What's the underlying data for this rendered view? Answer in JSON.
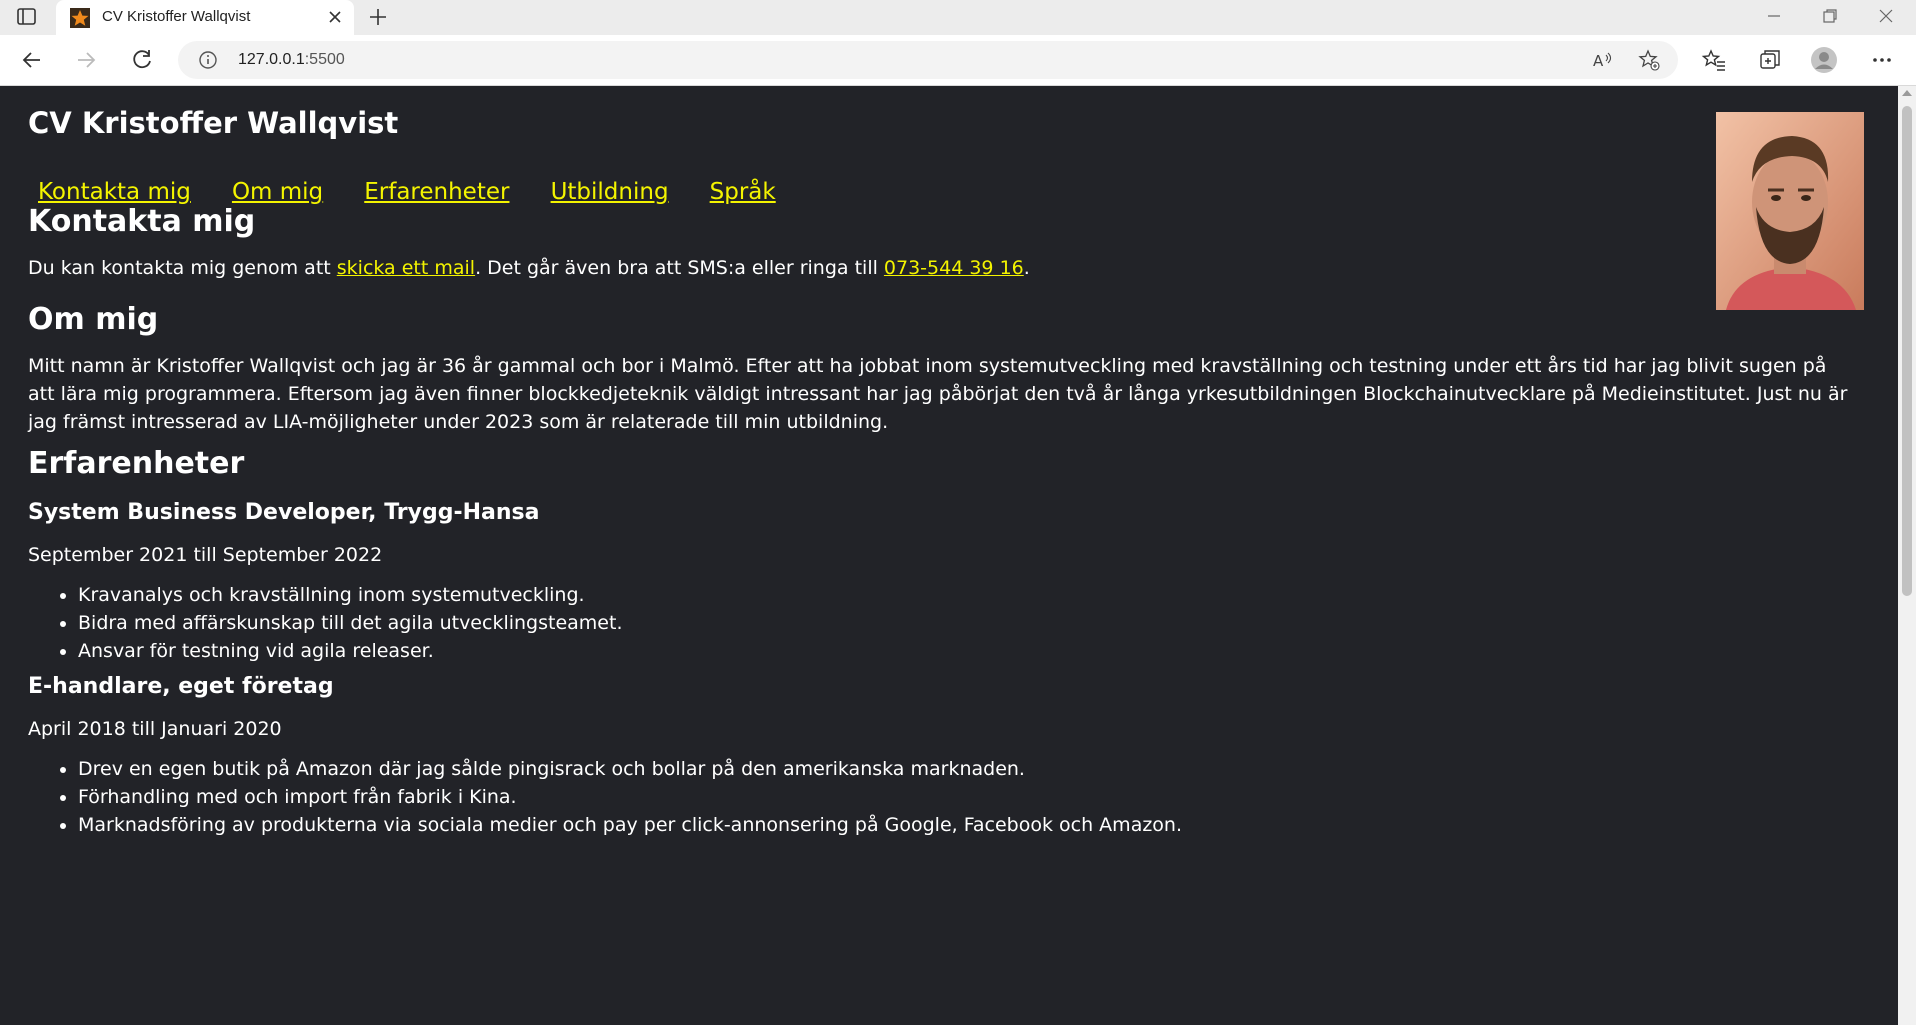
{
  "browser": {
    "tab_title": "CV Kristoffer Wallqvist",
    "url_host": "127.0.0.1",
    "url_rest": ":5500"
  },
  "page": {
    "title": "CV Kristoffer Wallqvist",
    "nav": [
      "Kontakta mig",
      "Om mig",
      "Erfarenheter",
      "Utbildning",
      "Språk"
    ],
    "contact": {
      "heading": "Kontakta mig",
      "text_before": "Du kan kontakta mig genom att ",
      "mail_link": "skicka ett mail",
      "text_middle": ". Det går även bra att SMS:a eller ringa till ",
      "phone_link": "073-544 39 16",
      "text_after": "."
    },
    "about": {
      "heading": "Om mig",
      "text": "Mitt namn är Kristoffer Wallqvist och jag är 36 år gammal och bor i Malmö. Efter att ha jobbat inom systemutveckling med kravställning och testning under ett års tid har jag blivit sugen på att lära mig programmera. Eftersom jag även finner blockkedjeteknik väldigt intressant har jag påbörjat den två år långa yrkesutbildningen Blockchainutvecklare på Medieinstitutet. Just nu är jag främst intresserad av LIA-möjligheter under 2023 som är relaterade till min utbildning."
    },
    "experience": {
      "heading": "Erfarenheter",
      "jobs": [
        {
          "title": "System Business Developer, Trygg-Hansa",
          "period": "September 2021 till September 2022",
          "items": [
            "Kravanalys och kravställning inom systemutveckling.",
            "Bidra med affärskunskap till det agila utvecklingsteamet.",
            "Ansvar för testning vid agila releaser."
          ]
        },
        {
          "title": "E-handlare, eget företag",
          "period": "April 2018 till Januari 2020",
          "items": [
            "Drev en egen butik på Amazon där jag sålde pingisrack och bollar på den amerikanska marknaden.",
            "Förhandling med och import från fabrik i Kina.",
            "Marknadsföring av produkterna via sociala medier och pay per click-annonsering på Google, Facebook och Amazon."
          ]
        }
      ]
    }
  }
}
